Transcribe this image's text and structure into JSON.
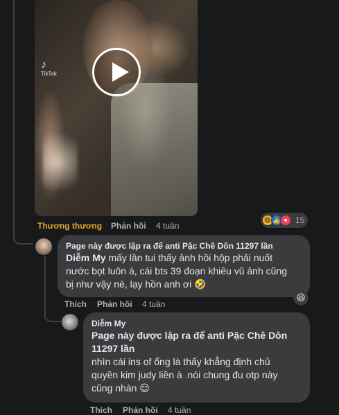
{
  "post_video": {
    "watermark": "TikTok"
  },
  "comment1": {
    "author": "Thương thương",
    "reply_label": "Phản hồi",
    "time": "4 tuần",
    "reaction_count": "15",
    "reaction_icons": [
      "laughing-emoji",
      "like-icon",
      "love-icon"
    ]
  },
  "reply1": {
    "author": "Page này được lập ra để anti Pặc Chê Dôn 11297 lần",
    "mention": "Diễm My",
    "line1_rest": " mấy lần tui thấy ảnh hồi hộp phải nuốt",
    "line2": "nước bọt luôn á, cái bts 39 đoạn khiêu vũ ảnh cũng",
    "line3": "bị như vậy nè, lạy hồn anh ơi 🤣",
    "like_label": "Thích",
    "reply_label": "Phản hồi",
    "time": "4 tuần",
    "reaction_icon": "laughing-emoji"
  },
  "reply2": {
    "author": "Diễm My",
    "mention_line1": "Page này được lập ra để anti Pặc Chê Dôn",
    "mention_line2": "11297 lần",
    "line1": "nhìn cái ins of ổng là thấy khẳng định chủ",
    "line2": "quyền kim judy liền à .nói chung đu otp này",
    "line3": "cũng nhàn 😌",
    "like_label": "Thích",
    "reply_label": "Phản hồi",
    "time": "4 tuần"
  },
  "colors": {
    "background": "#18191a",
    "bubble": "#3a3b3c",
    "text": "#e4e6eb",
    "secondary": "#b0b3b8",
    "author_gold": "#e4a82a"
  }
}
